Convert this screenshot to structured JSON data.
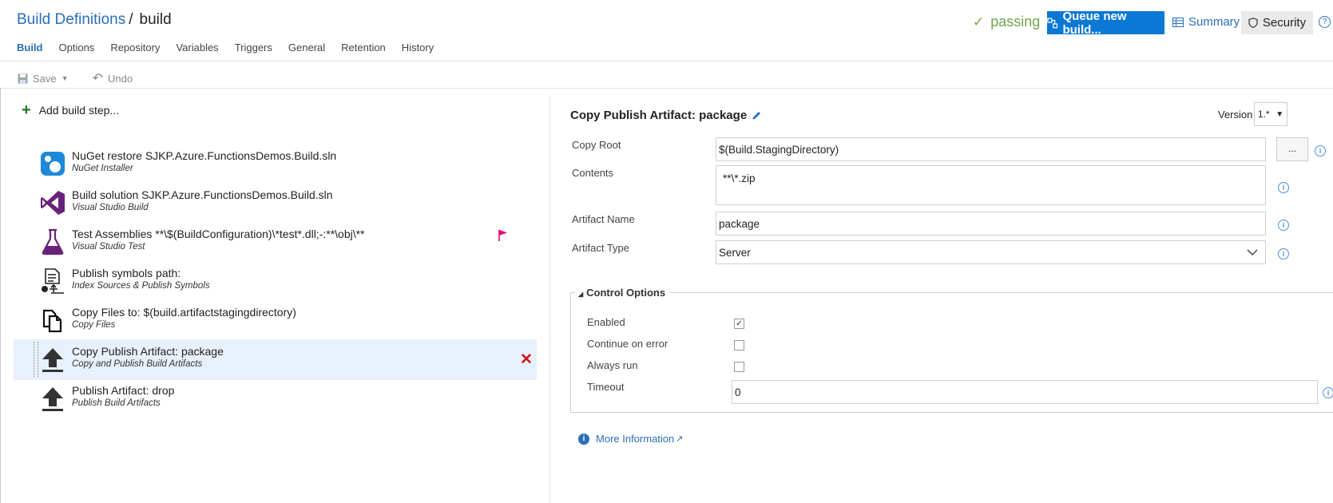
{
  "breadcrumb": {
    "parent": "Build Definitions",
    "separator": "/",
    "current": "build"
  },
  "header": {
    "status": "passing",
    "queue_button": "Queue new build...",
    "summary": "Summary",
    "security": "Security",
    "help": "?"
  },
  "tabs": [
    {
      "label": "Build"
    },
    {
      "label": "Options"
    },
    {
      "label": "Repository"
    },
    {
      "label": "Variables"
    },
    {
      "label": "Triggers"
    },
    {
      "label": "General"
    },
    {
      "label": "Retention"
    },
    {
      "label": "History"
    }
  ],
  "toolbar": {
    "save": "Save",
    "undo": "Undo"
  },
  "steps_panel": {
    "add_step": "Add build step...",
    "steps": [
      {
        "title": "NuGet restore SJKP.Azure.FunctionsDemos.Build.sln",
        "subtitle": "NuGet Installer",
        "icon": "nuget-icon"
      },
      {
        "title": "Build solution SJKP.Azure.FunctionsDemos.Build.sln",
        "subtitle": "Visual Studio Build",
        "icon": "visual-studio-icon"
      },
      {
        "title": "Test Assemblies **\\$(BuildConfiguration)\\*test*.dll;-:**\\obj\\**",
        "subtitle": "Visual Studio Test",
        "icon": "flask-icon"
      },
      {
        "title": "Publish symbols path:",
        "subtitle": "Index Sources & Publish Symbols",
        "icon": "publish-symbols-icon"
      },
      {
        "title": "Copy Files to: $(build.artifactstagingdirectory)",
        "subtitle": "Copy Files",
        "icon": "copy-files-icon"
      },
      {
        "title": "Copy Publish Artifact: package",
        "subtitle": "Copy and Publish Build Artifacts",
        "icon": "upload-icon"
      },
      {
        "title": "Publish Artifact: drop",
        "subtitle": "Publish Build Artifacts",
        "icon": "upload-icon"
      }
    ]
  },
  "details": {
    "title": "Copy Publish Artifact: package",
    "version_label": "Version",
    "version_value": "1.*",
    "fields": {
      "copy_root": {
        "label": "Copy Root",
        "value": "$(Build.StagingDirectory)"
      },
      "contents": {
        "label": "Contents",
        "value": "**\\*.zip"
      },
      "artifact_name": {
        "label": "Artifact Name",
        "value": "package"
      },
      "artifact_type": {
        "label": "Artifact Type",
        "value": "Server"
      }
    },
    "browse_button": "...",
    "control_options": {
      "title": "Control Options",
      "enabled": "Enabled",
      "continue_on_error": "Continue on error",
      "always_run": "Always run",
      "timeout": "Timeout",
      "timeout_value": "0",
      "enabled_checked": true,
      "continue_on_error_checked": false,
      "always_run_checked": false
    },
    "more_info": "More Information"
  },
  "colors": {
    "accent": "#0a78d4",
    "link": "#2a6fb8",
    "passing": "#6fa34a",
    "delete": "#d01313",
    "flag": "#e6007e"
  }
}
